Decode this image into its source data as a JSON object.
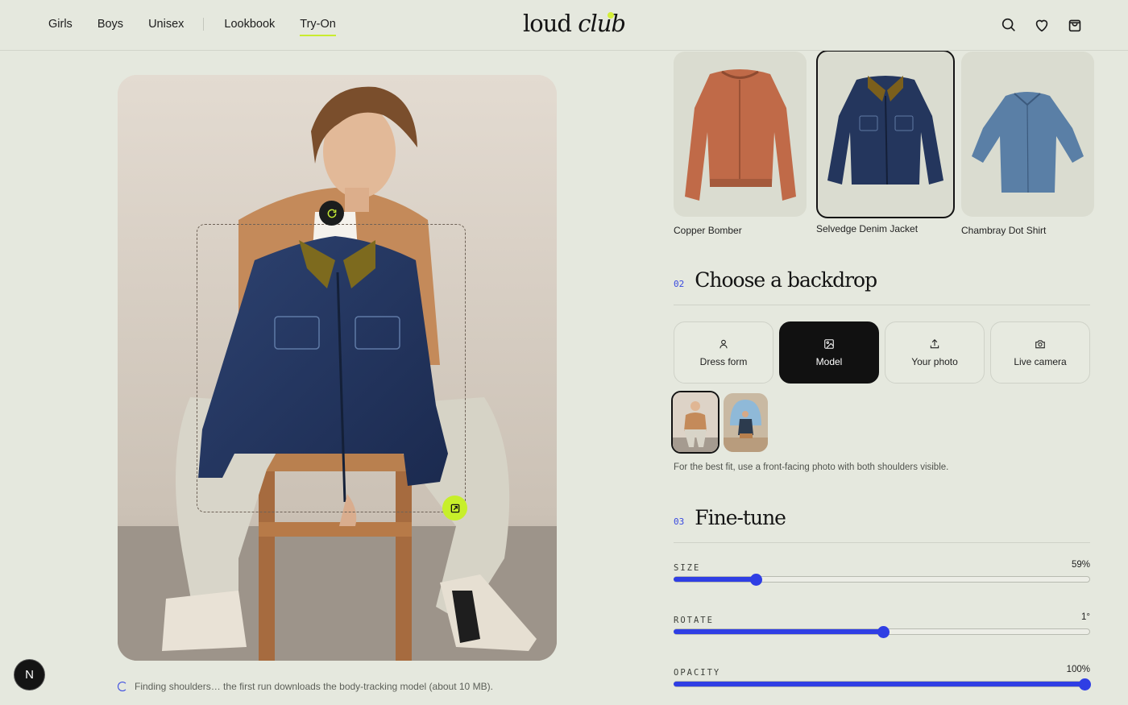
{
  "nav": {
    "items": [
      {
        "label": "Girls"
      },
      {
        "label": "Boys"
      },
      {
        "label": "Unisex"
      },
      {
        "label": "Lookbook"
      },
      {
        "label": "Try-On",
        "active": true
      }
    ]
  },
  "logo": {
    "word1": "loud",
    "word2": "club",
    "accent_color": "#d4ef3a"
  },
  "header_icons": [
    "search-icon",
    "heart-icon",
    "bag-icon"
  ],
  "products": [
    {
      "name": "Copper Bomber",
      "selected": false
    },
    {
      "name": "Selvedge Denim Jacket",
      "selected": true
    },
    {
      "name": "Chambray Dot Shirt",
      "selected": false
    }
  ],
  "backdrop_section": {
    "number": "02",
    "title": "Choose a backdrop"
  },
  "backdrops": [
    {
      "label": "Dress form",
      "icon": "person-icon",
      "active": false
    },
    {
      "label": "Model",
      "icon": "image-icon",
      "active": true
    },
    {
      "label": "Your photo",
      "icon": "upload-icon",
      "active": false
    },
    {
      "label": "Live camera",
      "icon": "camera-icon",
      "active": false
    }
  ],
  "hint": "For the best fit, use a front-facing photo with both shoulders visible.",
  "finetune_section": {
    "number": "03",
    "title": "Fine-tune"
  },
  "sliders": [
    {
      "label": "SIZE",
      "value_text": "59%",
      "fraction": 0.2
    },
    {
      "label": "ROTATE",
      "value_text": "1°",
      "fraction": 0.51
    },
    {
      "label": "OPACITY",
      "value_text": "100%",
      "fraction": 1.0
    }
  ],
  "status": "Finding shoulders… the first run downloads the body-tracking model (about 10 MB).",
  "badge": "N",
  "colors": {
    "accent_blue": "#2f3ee4",
    "accent_lime": "#c7ef2a",
    "background": "#e5e8de"
  }
}
